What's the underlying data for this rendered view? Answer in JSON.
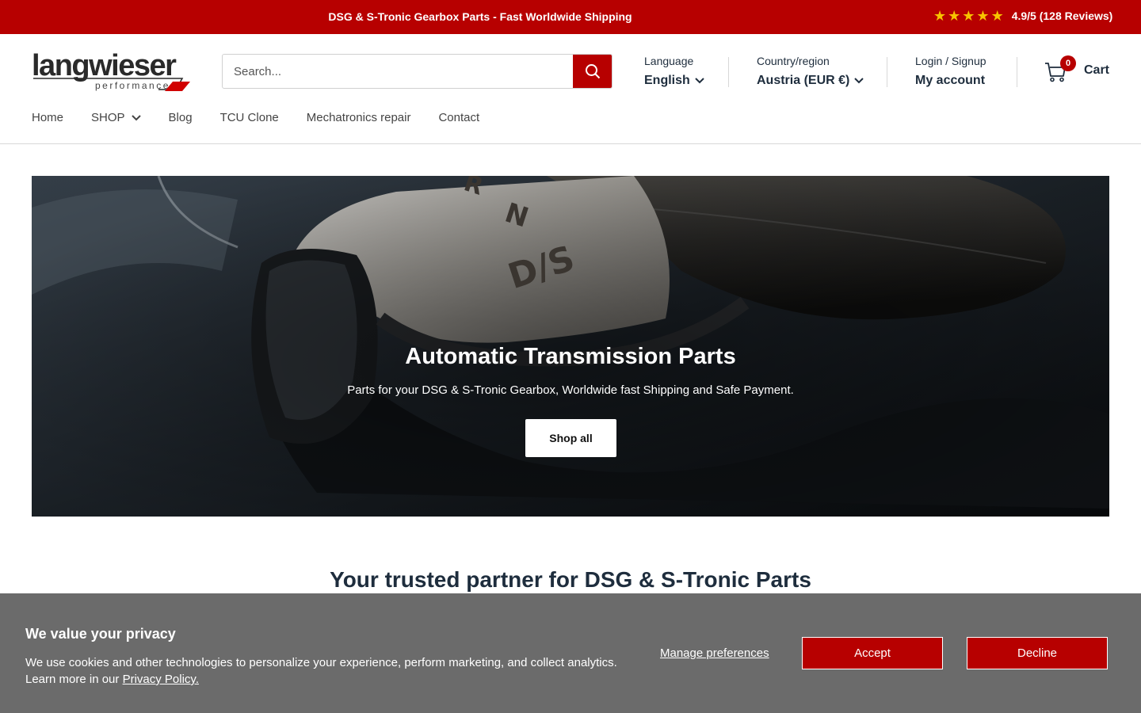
{
  "announcement": {
    "text": "DSG & S-Tronic Gearbox Parts - Fast Worldwide Shipping",
    "rating_text": "4.9/5 (128 Reviews)",
    "rating_stars": 5
  },
  "logo": {
    "word": "langwieser",
    "sub": "performance"
  },
  "search": {
    "placeholder": "Search..."
  },
  "language": {
    "label": "Language",
    "value": "English"
  },
  "country": {
    "label": "Country/region",
    "value": "Austria (EUR €)"
  },
  "account": {
    "label": "Login / Signup",
    "link": "My account"
  },
  "cart": {
    "count": "0",
    "label": "Cart"
  },
  "nav": {
    "items": [
      {
        "label": "Home"
      },
      {
        "label": "SHOP"
      },
      {
        "label": "Blog"
      },
      {
        "label": "TCU Clone"
      },
      {
        "label": "Mechatronics repair"
      },
      {
        "label": "Contact"
      }
    ]
  },
  "hero": {
    "title": "Automatic Transmission Parts",
    "subtitle": "Parts for your DSG & S-Tronic Gearbox, Worldwide fast Shipping and Safe Payment.",
    "button": "Shop all",
    "image_text": {
      "r": "R",
      "n": "N",
      "ds": "D/S"
    }
  },
  "trust_heading": "Your trusted partner for DSG & S-Tronic Parts",
  "cookie": {
    "title": "We value your privacy",
    "text": "We use cookies and other technologies to personalize your experience, perform marketing, and collect analytics. Learn more in our",
    "policy_link": "Privacy Policy.",
    "manage": "Manage preferences",
    "accept": "Accept",
    "decline": "Decline"
  },
  "colors": {
    "brand_red": "#b70000",
    "star": "#f7c300",
    "cookie_bg": "#6b6b6b"
  }
}
